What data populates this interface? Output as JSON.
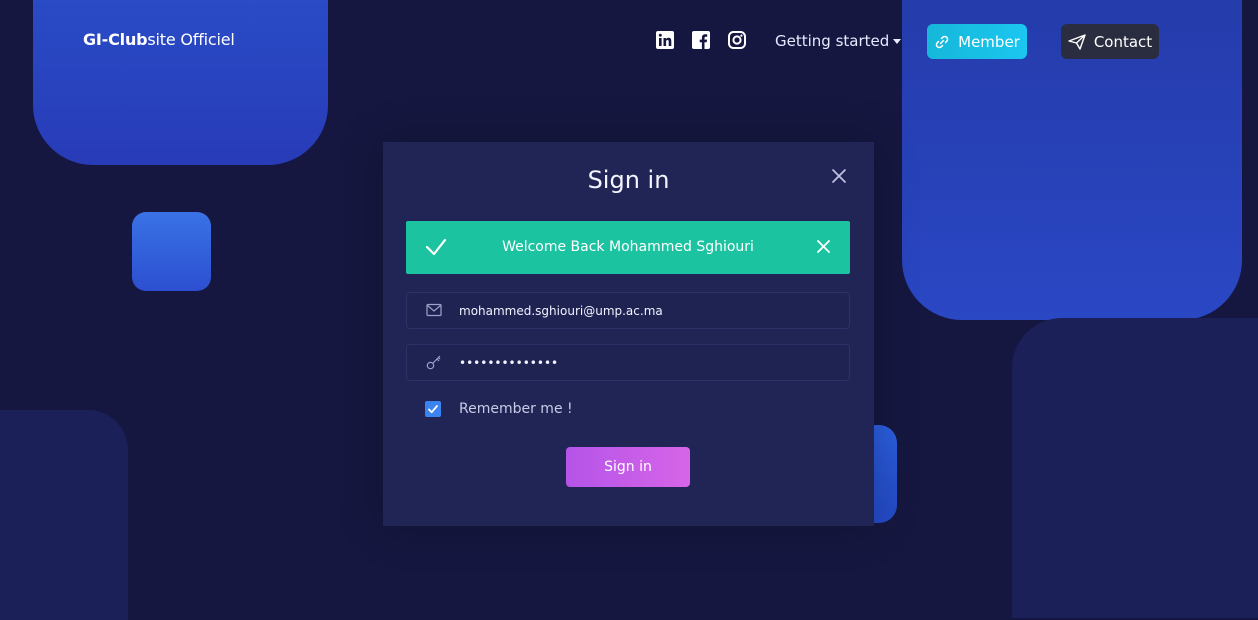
{
  "navbar": {
    "brand_bold": "GI-Club",
    "brand_rest": "site Officiel",
    "social": [
      {
        "name": "linkedin-icon"
      },
      {
        "name": "facebook-icon"
      },
      {
        "name": "instagram-icon"
      }
    ],
    "getting_started": "Getting started",
    "member_label": "Member",
    "contact_label": "Contact",
    "colors": {
      "member": "#16b7d9",
      "contact": "#2a2d3f"
    }
  },
  "modal": {
    "title": "Sign in",
    "alert": {
      "text": "Welcome Back Mohammed Sghiouri",
      "color": "#1cc3a0"
    },
    "email_value": "mohammed.sghiouri@ump.ac.ma",
    "password_value": "••••••••••••••",
    "remember_label": "Remember me !",
    "remember_checked": true,
    "submit_label": "Sign in",
    "submit_color": "#c45be8"
  }
}
